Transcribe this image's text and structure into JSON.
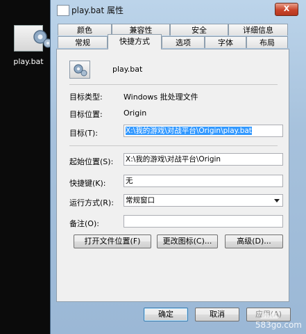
{
  "desktop": {
    "icon_label": "play.bat"
  },
  "window": {
    "title": "play.bat 属性",
    "close_glyph": "X"
  },
  "tabs_row_back": [
    "颜色",
    "兼容性",
    "安全",
    "详细信息"
  ],
  "tabs_row_front": [
    "常规",
    "快捷方式",
    "选项",
    "字体",
    "布局"
  ],
  "file_name": "play.bat",
  "fields": {
    "target_type_label": "目标类型:",
    "target_type_value": "Windows 批处理文件",
    "target_location_label": "目标位置:",
    "target_location_value": "Origin",
    "target_label": "目标(T):",
    "target_value": "X:\\我的游戏\\对战平台\\Origin\\play.bat",
    "start_in_label": "起始位置(S):",
    "start_in_value": "X:\\我的游戏\\对战平台\\Origin",
    "shortcut_key_label": "快捷键(K):",
    "shortcut_key_value": "无",
    "run_label": "运行方式(R):",
    "run_value": "常规窗口",
    "comment_label": "备注(O):",
    "comment_value": ""
  },
  "buttons": {
    "open_location": "打开文件位置(F)",
    "change_icon": "更改图标(C)...",
    "advanced": "高级(D)...",
    "ok": "确定",
    "cancel": "取消",
    "apply": "应用(A)"
  },
  "watermark": {
    "text": "583go.com"
  }
}
